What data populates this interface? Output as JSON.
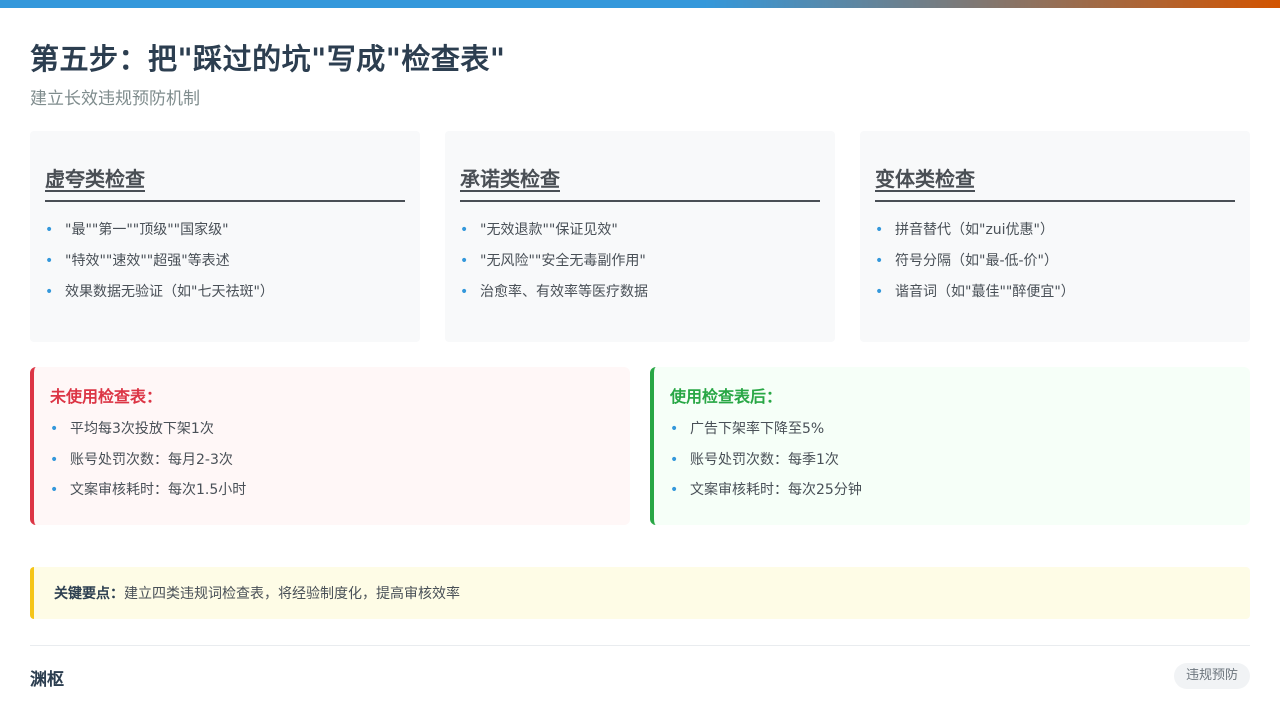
{
  "header": {
    "title": "第五步：把\"踩过的坑\"写成\"检查表\"",
    "subtitle": "建立长效违规预防机制"
  },
  "cards": [
    {
      "title": "虚夸类检查",
      "items": [
        "\"最\"\"第一\"\"顶级\"\"国家级\"",
        "\"特效\"\"速效\"\"超强\"等表述",
        "效果数据无验证（如\"七天祛斑\"）"
      ]
    },
    {
      "title": "承诺类检查",
      "items": [
        "\"无效退款\"\"保证见效\"",
        "\"无风险\"\"安全无毒副作用\"",
        "治愈率、有效率等医疗数据"
      ]
    },
    {
      "title": "变体类检查",
      "items": [
        "拼音替代（如\"zui优惠\"）",
        "符号分隔（如\"最-低-价\"）",
        "谐音词（如\"蕞佳\"\"醉便宜\"）"
      ]
    }
  ],
  "comparison": {
    "before": {
      "title": "未使用检查表：",
      "items": [
        "平均每3次投放下架1次",
        "账号处罚次数：每月2-3次",
        "文案审核耗时：每次1.5小时"
      ]
    },
    "after": {
      "title": "使用检查表后：",
      "items": [
        "广告下架率下降至5%",
        "账号处罚次数：每季1次",
        "文案审核耗时：每次25分钟"
      ]
    }
  },
  "key_point": {
    "label": "关键要点：",
    "text": "建立四类违规词检查表，将经验制度化，提高审核效率"
  },
  "footer": {
    "brand": "渊枢",
    "tag": "违规预防"
  },
  "colors": {
    "accent_blue": "#3498db",
    "accent_orange": "#d35400",
    "bad_red": "#dc3545",
    "good_green": "#28a745",
    "key_yellow": "#f5c518"
  }
}
